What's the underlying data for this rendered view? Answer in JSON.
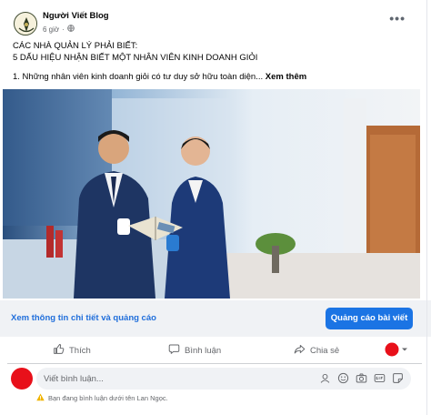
{
  "post": {
    "author": "Người Viết Blog",
    "time": "6 giờ",
    "dot": "·",
    "line1": "CÁC NHÀ QUẢN LÝ PHẢI BIẾT:",
    "line2": "5 DẤU HIỆU NHẬN BIẾT MỘT NHÂN VIÊN KINH DOANH GIỎI",
    "line3": "1. Những nhân viên kinh doanh giỏi có tư duy sở hữu toàn diện... ",
    "see_more": "Xem thêm"
  },
  "link_bar": {
    "details": "Xem thông tin chi tiết và quảng cáo",
    "promote": "Quảng cáo bài viết"
  },
  "actions": {
    "like": "Thích",
    "comment": "Bình luận",
    "share": "Chia sẻ"
  },
  "comment": {
    "placeholder": "Viết bình luận...",
    "notice": "Bạn đang bình luận dưới tên Lan Ngọc."
  },
  "colors": {
    "accent": "#1b74e4",
    "link": "#216fdb",
    "redacted": "#e8101a"
  }
}
